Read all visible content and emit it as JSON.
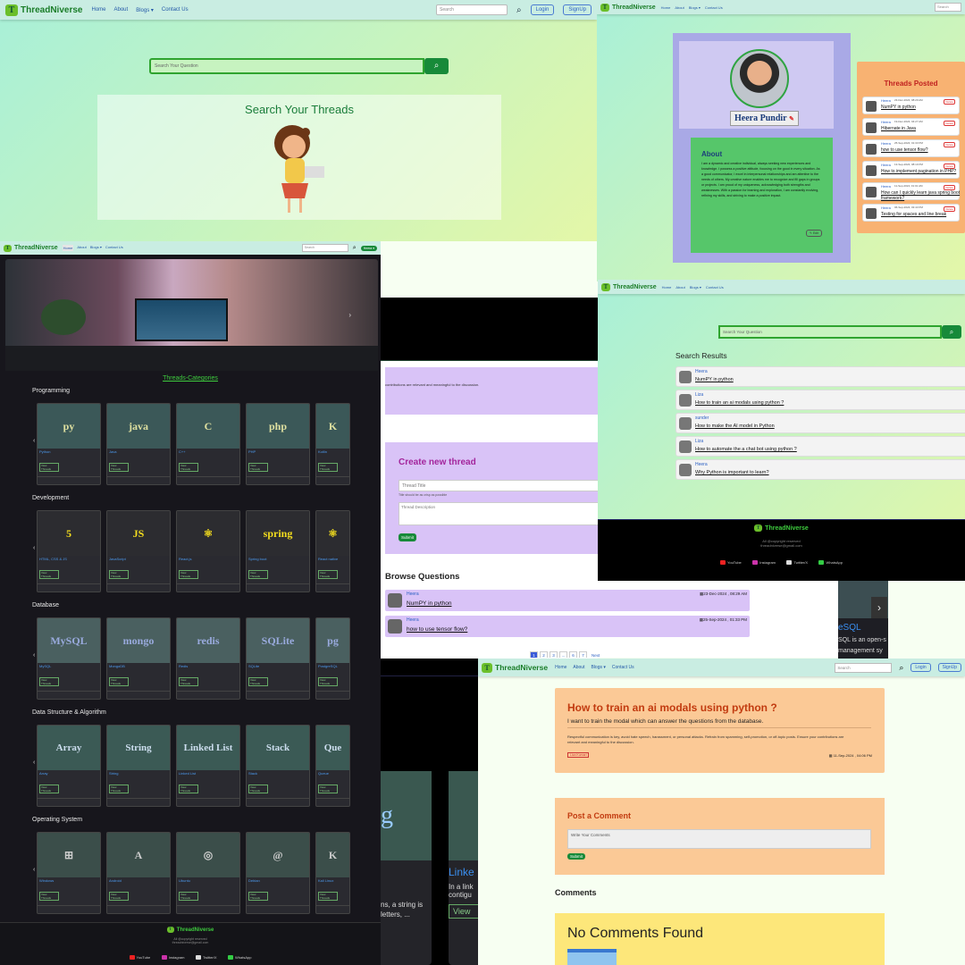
{
  "brand": "ThreadNiverse",
  "nav": {
    "home": "Home",
    "about": "About",
    "blogs": "Blogs",
    "contact": "Contact Us",
    "search_placeholder": "Search",
    "login": "Login",
    "signup": "SignUp"
  },
  "landing": {
    "search_placeholder": "Search Your Question",
    "heading": "Search Your Threads"
  },
  "profile": {
    "name": "Heera Pundir",
    "about_title": "About",
    "about_text": "I am a dynamic and creative individual, always seeking new experiences and knowledge. I possess a positive attitude, focusing on the good in every situation. As a good communicator, I excel in interpersonal relationships and am attentive to the needs of others. My creative nature enables me to recognize and fill gaps in groups or projects. I am proud of my uniqueness, acknowledging both strengths and weaknesses. With a passion for learning and exploration, I am constantly evolving, refining my skills, and striving to make a positive impact.",
    "edit": "Edit",
    "threads_title": "Threads Posted",
    "delete": "Delete",
    "threads": [
      {
        "name": "Heera",
        "date": "23-Dec-2024, 08:29 AM",
        "title": "NumPY in python"
      },
      {
        "name": "Heera",
        "date": "19-Dec-2024, 04:27 AM",
        "title": "Hibernate in Java"
      },
      {
        "name": "Heera",
        "date": "25-Sep-2024, 01:33 PM",
        "title": "how to use tensor flow?"
      },
      {
        "name": "Heera",
        "date": "13-Sep-2024, 08:19 PM",
        "title": "How to implement pagination in PHP?"
      },
      {
        "name": "Heera",
        "date": "11-Sep-2024, 01:01 AM",
        "title": "How can I quickly learn java spring boot framework?"
      },
      {
        "name": "Heera",
        "date": "06-Sep-2024, 03:43 PM",
        "title": "Testing for spaces and line break"
      }
    ]
  },
  "home": {
    "hello": "Heera",
    "categories_title": "Threads-Categories",
    "view_threads": "View Threads",
    "sections": [
      {
        "title": "Programming",
        "cards": [
          {
            "t": "Python",
            "img": "py"
          },
          {
            "t": "Java",
            "img": "java"
          },
          {
            "t": "C++",
            "img": "C"
          },
          {
            "t": "PHP",
            "img": "php"
          },
          {
            "t": "Kotlin",
            "img": "K"
          }
        ]
      },
      {
        "title": "Development",
        "cards": [
          {
            "t": "HTML, CSS & JS",
            "img": "5"
          },
          {
            "t": "JavaScript",
            "img": "JS"
          },
          {
            "t": "React.js",
            "img": "⚛"
          },
          {
            "t": "Spring boot",
            "img": "spring"
          },
          {
            "t": "React native",
            "img": "⚛"
          }
        ]
      },
      {
        "title": "Database",
        "cards": [
          {
            "t": "MySQL",
            "img": "MySQL"
          },
          {
            "t": "MongoDB",
            "img": "mongo"
          },
          {
            "t": "Redis",
            "img": "redis"
          },
          {
            "t": "SQLite",
            "img": "SQLite"
          },
          {
            "t": "PostgreSQL",
            "img": "pg"
          }
        ]
      },
      {
        "title": "Data Structure & Algorithm",
        "cards": [
          {
            "t": "Array",
            "img": "Array"
          },
          {
            "t": "String",
            "img": "String"
          },
          {
            "t": "Linked List",
            "img": "Linked List"
          },
          {
            "t": "Stack",
            "img": "Stack"
          },
          {
            "t": "Queue",
            "img": "Que"
          }
        ]
      },
      {
        "title": "Operating System",
        "cards": [
          {
            "t": "Windows",
            "img": "⊞"
          },
          {
            "t": "Android",
            "img": "A"
          },
          {
            "t": "Ubuntu",
            "img": "◎"
          },
          {
            "t": "Debian",
            "img": "@"
          },
          {
            "t": "Kali Linux",
            "img": "K"
          }
        ]
      }
    ]
  },
  "footer": {
    "copyright": "All @copyright reserved",
    "email": "threadniverse@gmail.com",
    "youtube": "YouTube",
    "instagram": "Instagram",
    "twitter": "Twitter/X",
    "whatsapp": "WhatsApp"
  },
  "create": {
    "title": "Create new thread",
    "title_placeholder": "Thread Title",
    "hint": "Title should be as crisp as possible",
    "desc_placeholder": "Thread Description",
    "submit": "Submit",
    "partial_text": "contributions are relevant and meaningful to the discussion.",
    "browse": "Browse Questions",
    "questions": [
      {
        "name": "Heera",
        "title": "NumPY in python",
        "date": "23-Dec-2024 , 08:29 AM"
      },
      {
        "name": "Heera",
        "title": "how to use tensor flow?",
        "date": "25-Sep-2024 , 01:33 PM"
      }
    ],
    "pages": [
      "1",
      "2",
      "3",
      "...",
      "6",
      "7",
      "Next"
    ]
  },
  "results": {
    "title": "Search Results",
    "items": [
      {
        "name": "Heera",
        "title": "NumPY in python"
      },
      {
        "name": "Liza",
        "title": "How to train an ai modals using python ?"
      },
      {
        "name": "sunder",
        "title": "How to make the AI model in Python"
      },
      {
        "name": "Liza",
        "title": "How to automate the a chat bot using python ?"
      },
      {
        "name": "Heera",
        "title": "Why Python is important to learn?"
      }
    ]
  },
  "thread": {
    "title": "How to train an ai modals using python ?",
    "desc": "I want to train the modal which can answer the questions from the database.",
    "rules": "Respectful communication is key, avoid hate speech, harassment, or personal attacks. Refrain from spamming, self-promotion, or off-topic posts. Ensure your contributions are relevant and meaningful to the discussion.",
    "user": "Liza Kumari",
    "date": "11-Sep-2024 , 04:06 PM",
    "post_title": "Post a Comment",
    "comment_placeholder": "Write Your Comments",
    "submit": "Submit",
    "comments_title": "Comments",
    "no_comments": "No Comments Found"
  },
  "frag": {
    "postgre": "eSQL",
    "postgre_desc": "SQL is an open-s",
    "postgre_desc2": "management sy",
    "linked": "Linke",
    "linked_desc": "In a link",
    "linked_desc2": "contigu",
    "string_desc": "ns, a string is",
    "string_desc2": "letters, ...",
    "view": "View"
  }
}
